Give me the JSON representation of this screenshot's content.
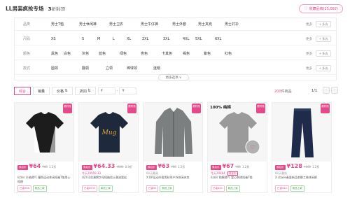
{
  "header": {
    "title": "LL男装疯抢专场",
    "count_number": "3",
    "count_suffix": "折封顶",
    "fav_label": "收藏品牌(25,082)"
  },
  "filters": {
    "rows": [
      {
        "label": "品类",
        "options": [
          "男士T恤",
          "男士休闲裤",
          "男士卫衣",
          "男士牛仔裤",
          "男士外套",
          "男士夹克",
          "男士衬衫"
        ]
      },
      {
        "label": "尺码",
        "options": [
          "XS",
          "S",
          "M",
          "L",
          "XL",
          "2XL",
          "3XL",
          "4XL",
          "5XL",
          "6XL"
        ]
      },
      {
        "label": "颜色",
        "options": [
          "黑色",
          "白色",
          "灰色",
          "蓝色",
          "绿色",
          "杏色",
          "卡其色",
          "褐色",
          "紫色",
          "红色"
        ]
      },
      {
        "label": "款式",
        "options": [
          "圆领",
          "翻领",
          "立领",
          "棒球领",
          "连帽"
        ]
      }
    ],
    "more_label": "更多",
    "multi_label": "+ 多选",
    "expand_label": "更多选项 ∨"
  },
  "sortbar": {
    "options": [
      "综合",
      "销量",
      "价格",
      "折扣"
    ],
    "price_min": "¥",
    "price_max": "¥",
    "total_count": "200",
    "total_suffix": "件商品",
    "page": "1/1",
    "prev": "‹",
    "next": "›"
  },
  "products": [
    {
      "label": "券后价",
      "price": "¥64",
      "old": "¥68",
      "disc": "1.2折",
      "sub": "",
      "title": "lizzer 半袖透气 撞色运动休闲短袖T恤男士纯棉",
      "chips": [
        "已省¥98",
        "新品上架"
      ],
      "img": "tshirt-black",
      "tag": "限时抢"
    },
    {
      "label": "券后价",
      "price": "¥64.33",
      "old": "¥600",
      "disc": "0.9折",
      "sub": "今天20¥59.33",
      "title": "UZI 印花潮牌字母短袖男士潮流宽松",
      "chips": [
        "已省¥535",
        "新品上架"
      ],
      "img": "tshirt-navy",
      "tag": "限时抢"
    },
    {
      "label": "券后价",
      "price": "¥63",
      "old": "¥68",
      "disc": "1.2折",
      "sub": "60天最高",
      "title": "X DP运动外套男秋季户外休闲夹克",
      "chips": [
        "已省¥5",
        "新品上架"
      ],
      "img": "jacket",
      "tag": "限时抢"
    },
    {
      "label": "券后价",
      "price": "¥67",
      "old": "¥68",
      "disc": "1.2折",
      "sub": "今天20¥64 ",
      "sub_tag": "限量购",
      "title": "lizzer 纯棉透气 爱心刺绣短袖T恤",
      "chips": [
        "已省¥45",
        "新品上架"
      ],
      "img": "tshirt-grey",
      "tag": "限时抢",
      "badge": "100% 纯棉"
    },
    {
      "label": "券后价",
      "price": "¥128",
      "old": "¥168",
      "disc": "1.2折",
      "sub": "60天最低",
      "title": "X cbaile春夏新品束脚工装休闲裤",
      "chips": [
        "已省¥40",
        "新品上架"
      ],
      "img": "pants",
      "tag": "限时抢"
    }
  ],
  "colors": {
    "accent": "#e24a8a",
    "green": "#3ea34a"
  }
}
